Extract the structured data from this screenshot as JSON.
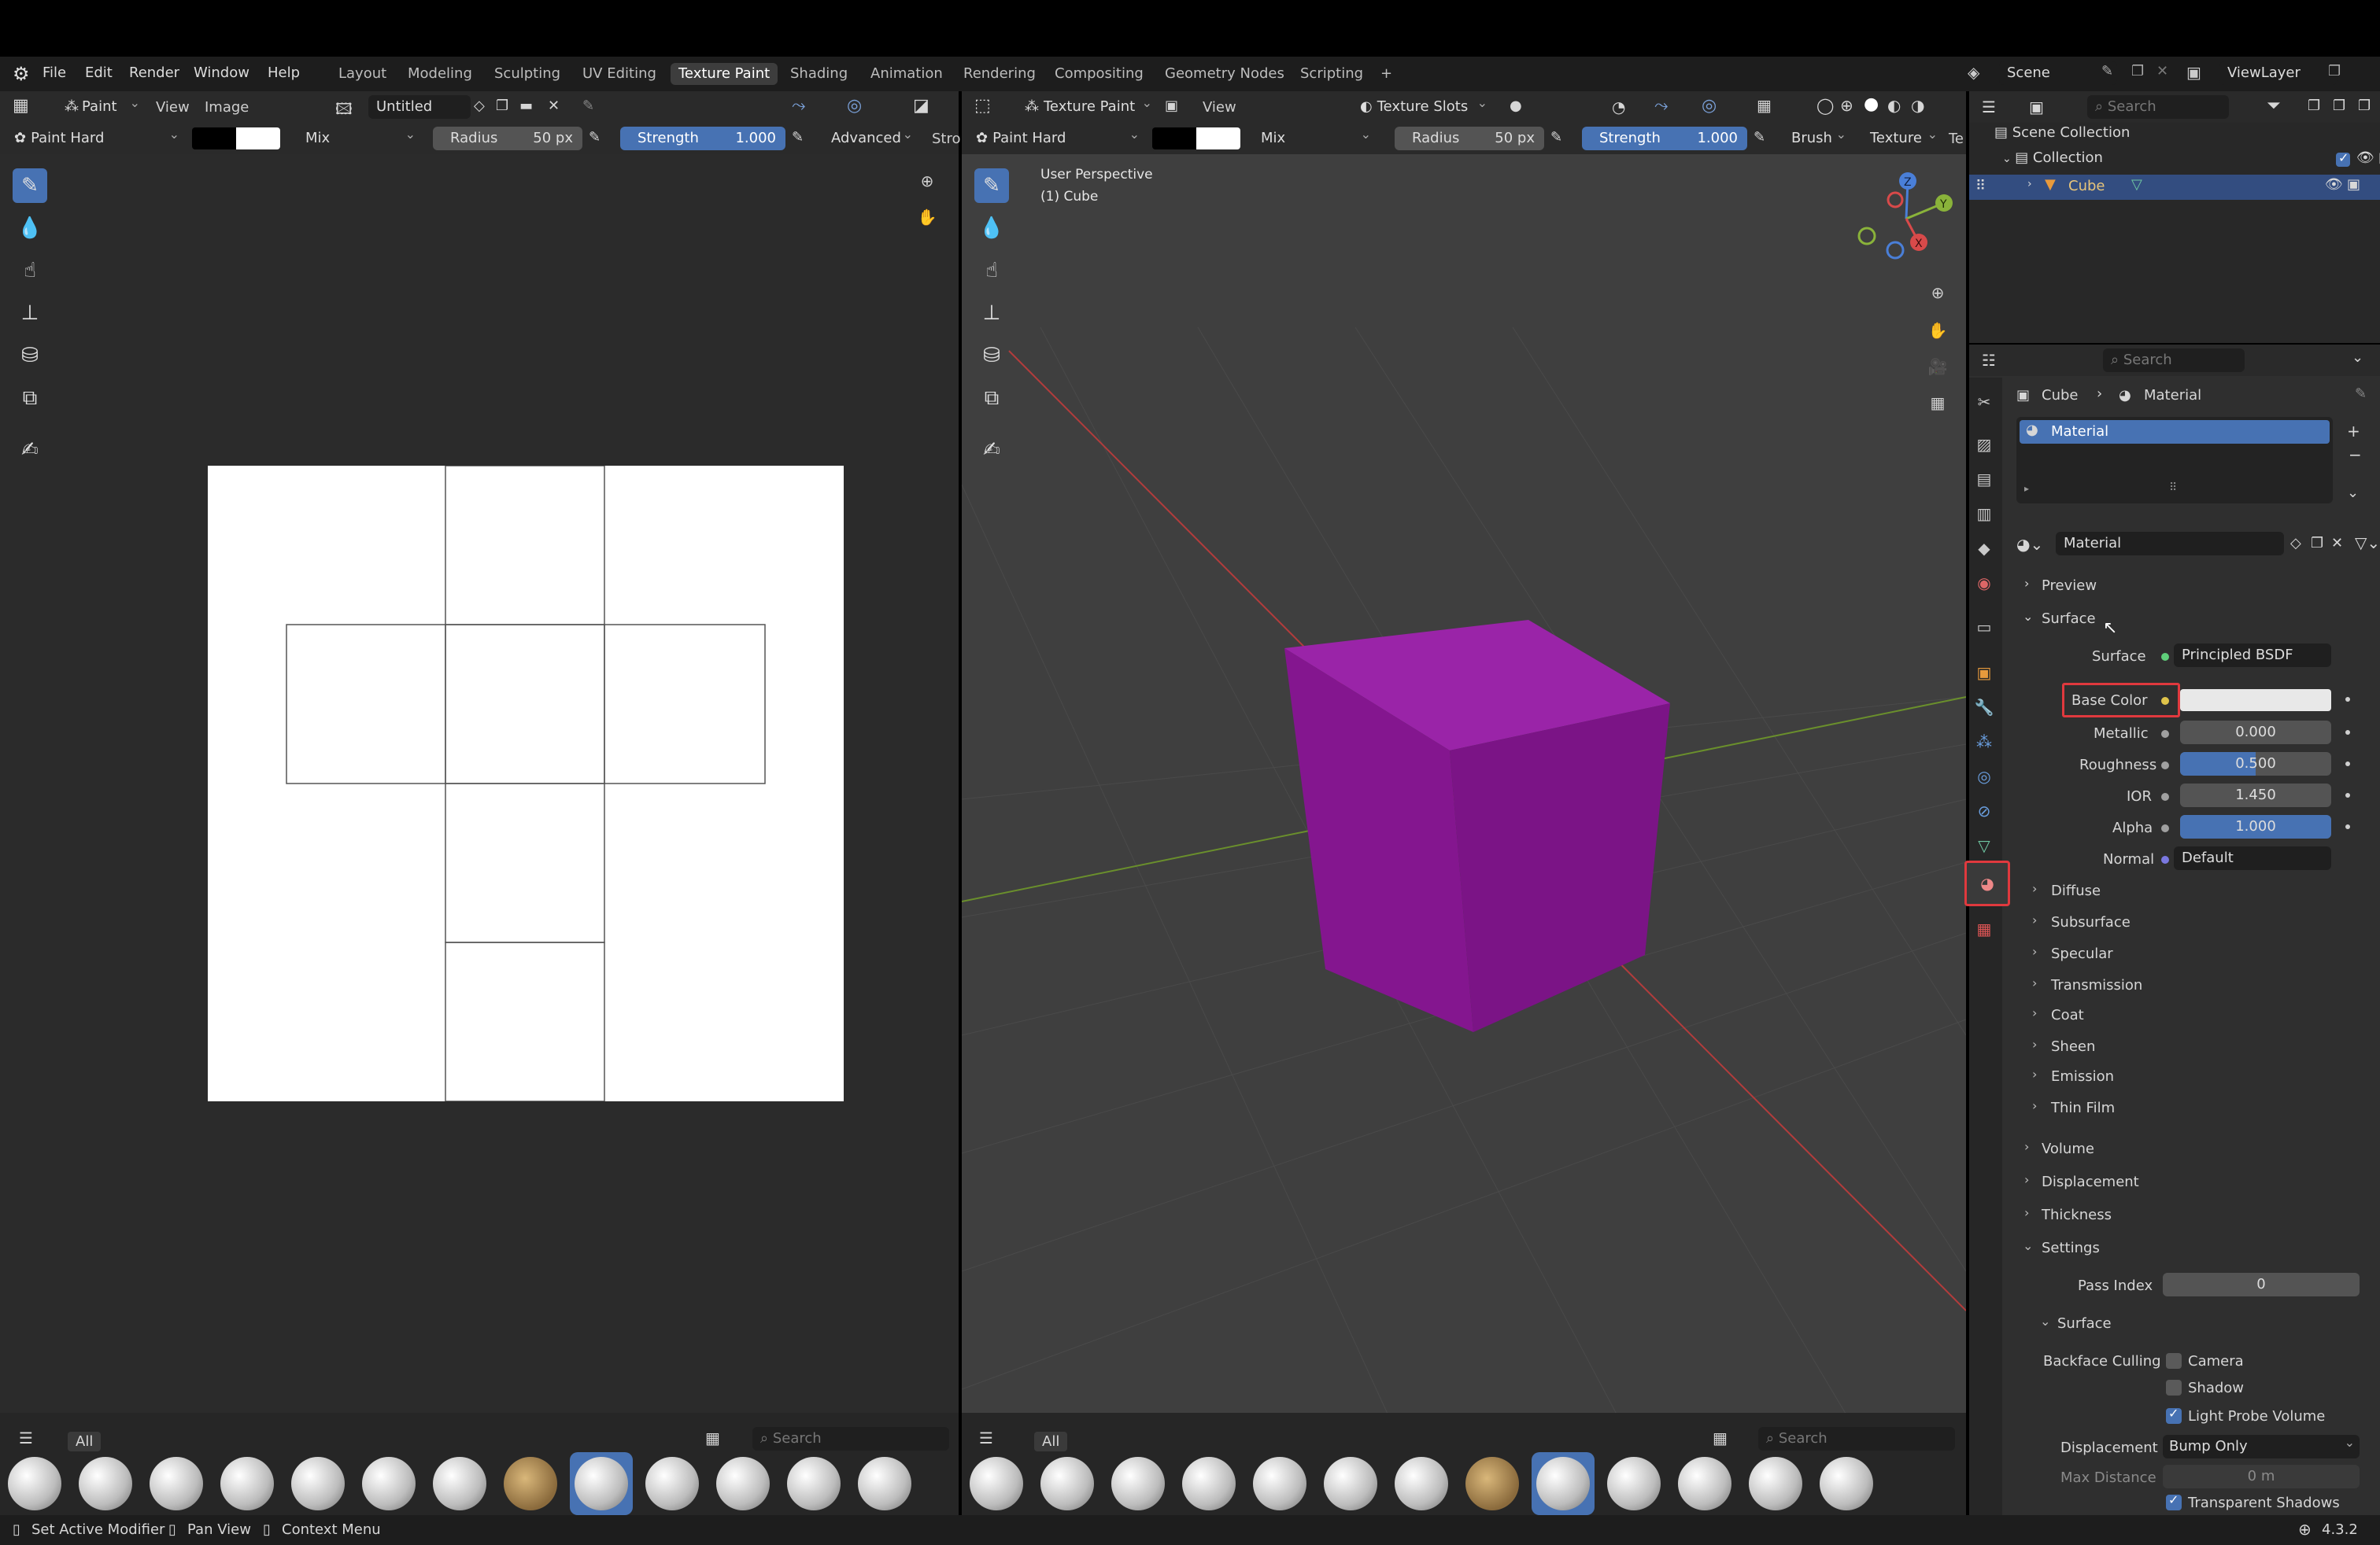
{
  "menu": {
    "items": [
      "File",
      "Edit",
      "Render",
      "Window",
      "Help"
    ],
    "workspaces": [
      "Layout",
      "Modeling",
      "Sculpting",
      "UV Editing",
      "Texture Paint",
      "Shading",
      "Animation",
      "Rendering",
      "Compositing",
      "Geometry Nodes",
      "Scripting"
    ],
    "add_tab": "+",
    "scene": "Scene",
    "view_layer": "ViewLayer"
  },
  "image_editor": {
    "mode": "Paint",
    "view": "View",
    "image": "Image",
    "image_name": "Untitled",
    "brush": "Paint Hard",
    "blend": "Mix",
    "radius_label": "Radius",
    "radius_value": "50 px",
    "strength_label": "Strength",
    "strength_value": "1.000",
    "advanced": "Advanced",
    "stroke_trunc": "Stro",
    "asset_filter": "All",
    "search_placeholder": "Search"
  },
  "viewport3d": {
    "mode": "Texture Paint",
    "view": "View",
    "texture_slots": "Texture Slots",
    "brush": "Paint Hard",
    "blend": "Mix",
    "radius_label": "Radius",
    "radius_value": "50 px",
    "strength_label": "Strength",
    "strength_value": "1.000",
    "brush_menu": "Brush",
    "texture_menu": "Texture",
    "texture_trunc": "Te",
    "perspective": "User Perspective",
    "object": "(1) Cube",
    "asset_filter": "All",
    "search_placeholder": "Search",
    "gizmo": {
      "x": "X",
      "y": "Y",
      "z": "Z"
    },
    "cube_color": "#8e1f9a"
  },
  "outliner": {
    "search_placeholder": "Search",
    "scene_collection": "Scene Collection",
    "collection": "Collection",
    "object": "Cube"
  },
  "properties": {
    "search_placeholder": "Search",
    "breadcrumb": {
      "object": "Cube",
      "material": "Material"
    },
    "slot": "Material",
    "material_name": "Material",
    "sections": {
      "preview": "Preview",
      "surface": "Surface",
      "volume": "Volume",
      "displacement": "Displacement",
      "thickness": "Thickness",
      "settings": "Settings"
    },
    "surface_shader_label": "Surface",
    "surface_shader": "Principled BSDF",
    "base_color_label": "Base Color",
    "metallic_label": "Metallic",
    "metallic": "0.000",
    "roughness_label": "Roughness",
    "roughness": "0.500",
    "roughness_fraction": 0.5,
    "ior_label": "IOR",
    "ior": "1.450",
    "alpha_label": "Alpha",
    "alpha": "1.000",
    "alpha_fraction": 1.0,
    "normal_label": "Normal",
    "normal": "Default",
    "subpanels": [
      "Diffuse",
      "Subsurface",
      "Specular",
      "Transmission",
      "Coat",
      "Sheen",
      "Emission",
      "Thin Film"
    ],
    "pass_index_label": "Pass Index",
    "pass_index": "0",
    "surface_sub": "Surface",
    "backface_culling_label": "Backface Culling",
    "camera": "Camera",
    "shadow": "Shadow",
    "light_probe": "Light Probe Volume",
    "displacement_label": "Displacement",
    "displacement_value": "Bump Only",
    "max_distance_label": "Max Distance",
    "max_distance": "0 m",
    "transparent_shadows": "Transparent Shadows"
  },
  "status": {
    "left": "Set Active Modifier",
    "middle": "Pan View",
    "right": "Context Menu",
    "version": "4.3.2"
  },
  "colors": {
    "accent": "#4772b3",
    "highlight": "#e0393e"
  }
}
